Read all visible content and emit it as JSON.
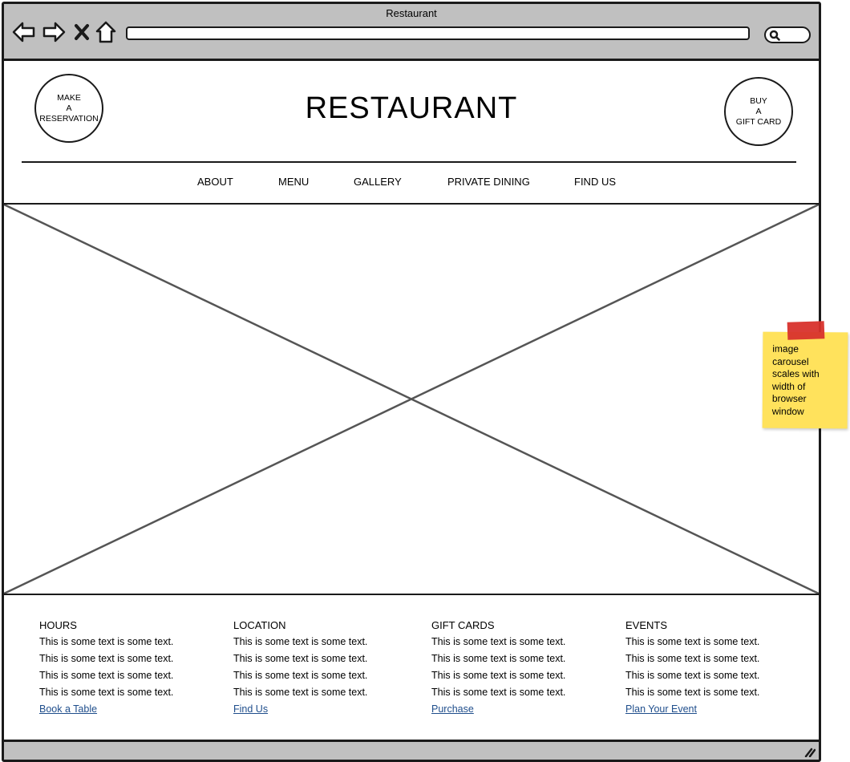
{
  "window": {
    "title": "Restaurant",
    "address": ""
  },
  "header": {
    "brand": "RESTAURANT",
    "reservation_button": "MAKE\nA\nRESERVATION",
    "gift_card_button": "BUY\nA\nGIFT CARD"
  },
  "nav": {
    "items": [
      "ABOUT",
      "MENU",
      "GALLERY",
      "PRIVATE DINING",
      "FIND US"
    ]
  },
  "footer": {
    "columns": [
      {
        "title": "HOURS",
        "lines": [
          "This is some text is some text.",
          "This is some text is some text.",
          "This is some text is some text.",
          "This is some text is some text."
        ],
        "link": "Book a Table"
      },
      {
        "title": "LOCATION",
        "lines": [
          "This is some text is some text.",
          "This is some text is some text.",
          "This is some text is some text.",
          "This is some text is some text."
        ],
        "link": "Find Us"
      },
      {
        "title": "GIFT CARDS",
        "lines": [
          "This is some text is some text.",
          "This is some text is some text.",
          "This is some text is some text.",
          "This is some text is some text."
        ],
        "link": "Purchase"
      },
      {
        "title": "EVENTS",
        "lines": [
          "This is some text is some text.",
          "This is some text is some text.",
          "This is some text is some text.",
          "This is some text is some text."
        ],
        "link": "Plan Your Event"
      }
    ]
  },
  "note": {
    "text": "image\ncarousel\nscales with\nwidth of\nbrowser\nwindow"
  },
  "icons": {
    "back": "back-arrow-icon",
    "forward": "forward-arrow-icon",
    "close": "close-icon",
    "home": "home-icon",
    "search": "search-icon",
    "resize": "resize-grip-icon"
  },
  "colors": {
    "chrome": "#c0c0c0",
    "link": "#1f4e8c",
    "sticky_note": "#ffe25c",
    "tape": "#d8322c"
  }
}
